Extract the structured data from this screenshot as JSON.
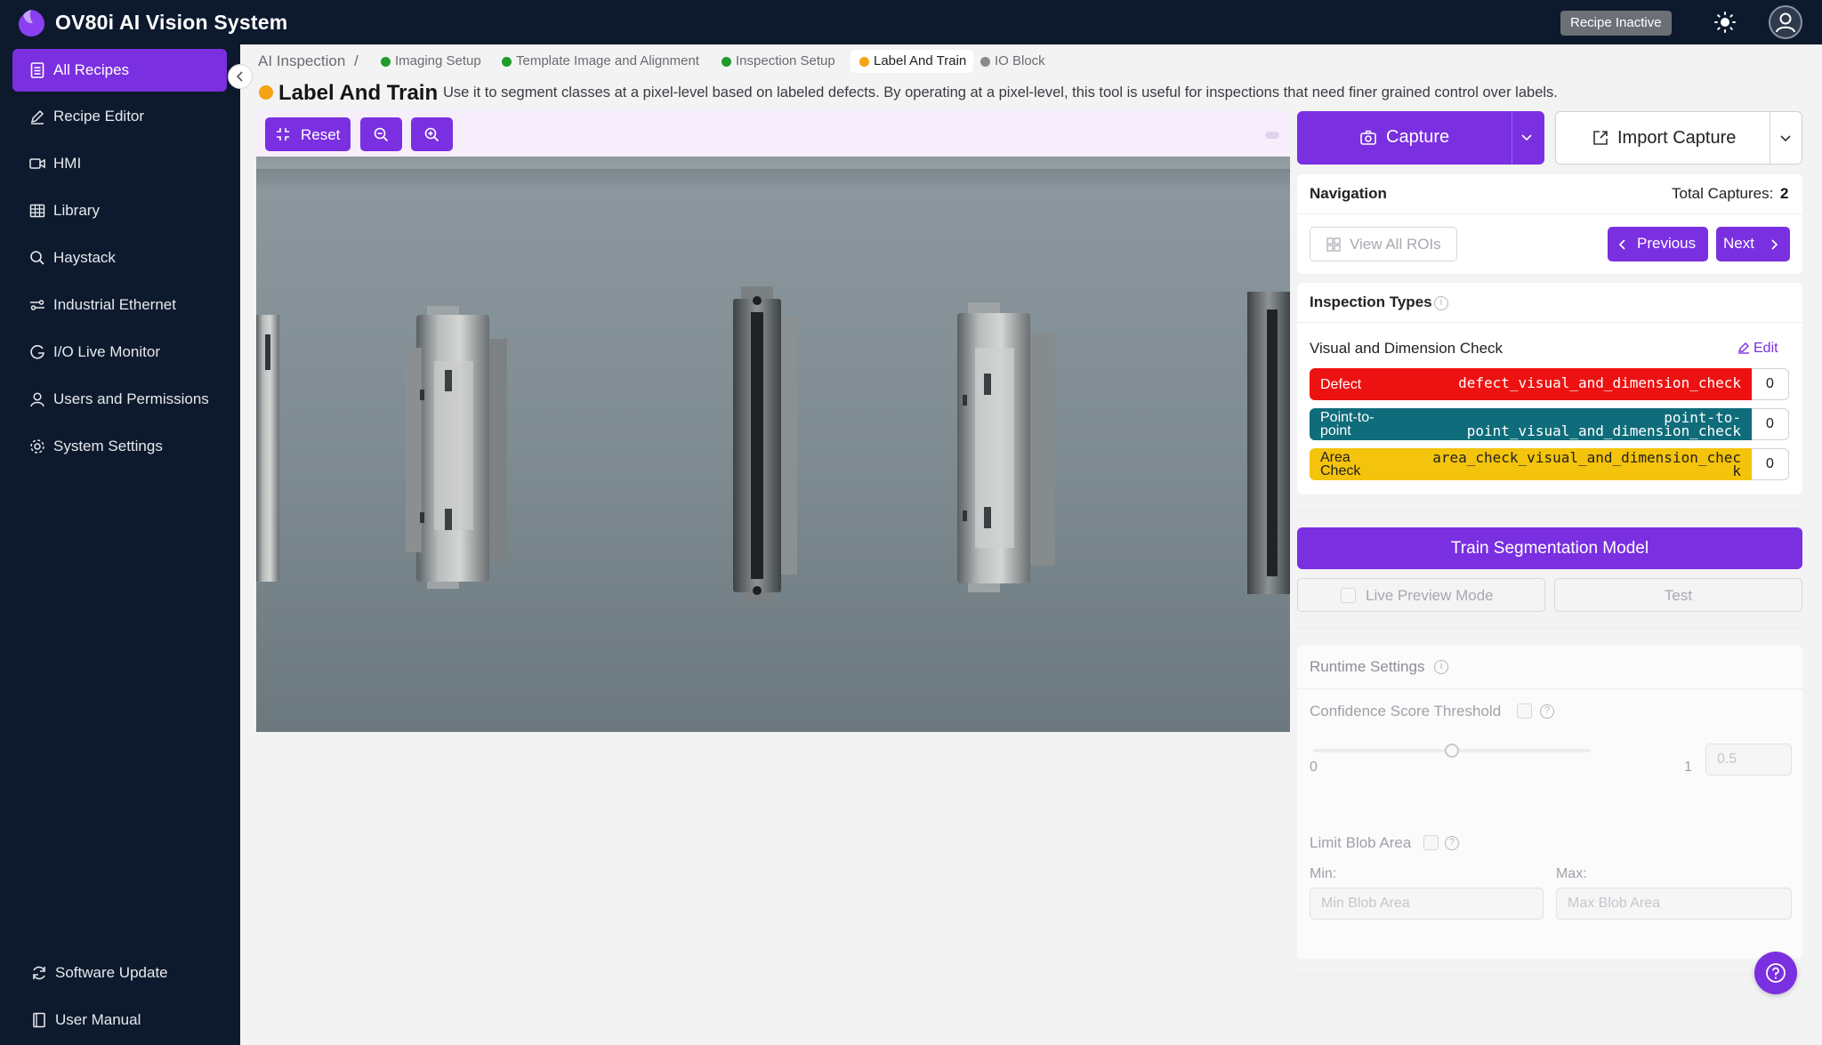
{
  "app": {
    "title": "OV80i AI Vision System",
    "recipe_status": "Recipe Inactive",
    "accent_color": "#7a2fe0",
    "nav_bg_color": "#0d1a2e"
  },
  "sidebar": {
    "items": [
      {
        "label": "All Recipes",
        "icon": "document-list-icon",
        "active": true
      },
      {
        "label": "Recipe Editor",
        "icon": "pencil-icon"
      },
      {
        "label": "HMI",
        "icon": "video-icon"
      },
      {
        "label": "Library",
        "icon": "grid-table-icon"
      },
      {
        "label": "Haystack",
        "icon": "search-icon"
      },
      {
        "label": "Industrial Ethernet",
        "icon": "network-icon"
      },
      {
        "label": "I/O Live Monitor",
        "icon": "monitor-g-icon"
      },
      {
        "label": "Users and Permissions",
        "icon": "user-icon"
      },
      {
        "label": "System Settings",
        "icon": "gear-icon"
      }
    ],
    "footer": [
      {
        "label": "Software Update",
        "icon": "refresh-icon"
      },
      {
        "label": "User Manual",
        "icon": "book-icon"
      }
    ]
  },
  "breadcrumb": {
    "root": "AI Inspection",
    "separator": "/",
    "steps": [
      {
        "label": "Imaging Setup",
        "status_color": "#1f9d2b"
      },
      {
        "label": "Template Image and Alignment",
        "status_color": "#1f9d2b"
      },
      {
        "label": "Inspection Setup",
        "status_color": "#1f9d2b"
      },
      {
        "label": "Label And Train",
        "status_color": "#f5a215",
        "current": true
      },
      {
        "label": "IO Block",
        "status_color": "#8a8a8a"
      }
    ]
  },
  "page": {
    "title": "Label And Train",
    "description": "Use it to segment classes at a pixel-level based on labeled defects. By operating at a pixel-level, this tool is useful for inspections that need finer grained control over labels."
  },
  "toolbar": {
    "reset_label": "Reset",
    "zoom_out_icon": "zoom-out-icon",
    "zoom_in_icon": "zoom-in-icon"
  },
  "capture": {
    "capture_label": "Capture",
    "import_label": "Import Capture"
  },
  "navigation": {
    "title": "Navigation",
    "total_label": "Total Captures:",
    "total_value": "2",
    "view_all_label": "View All ROIs",
    "previous_label": "Previous",
    "next_label": "Next"
  },
  "inspection_types": {
    "title": "Inspection Types",
    "group_name": "Visual and Dimension Check",
    "edit_label": "Edit",
    "rows": [
      {
        "name": "Defect",
        "code": "defect_visual_and_dimension_check",
        "count": "0",
        "color": "#ee1111",
        "text_color": "#ffffff"
      },
      {
        "name_line1": "Point-to-",
        "name_line2": "point",
        "code_line1": "point-to-",
        "code_line2": "point_visual_and_dimension_check",
        "count": "0",
        "color": "#0f6c7a",
        "text_color": "#ffffff"
      },
      {
        "name_line1": "Area",
        "name_line2": "Check",
        "code_line1": "area_check_visual_and_dimension_chec",
        "code_line2": "k",
        "count": "0",
        "color": "#f4c30c",
        "text_color": "#222222"
      }
    ]
  },
  "training": {
    "train_label": "Train Segmentation Model",
    "live_preview_label": "Live Preview Mode",
    "test_label": "Test"
  },
  "runtime": {
    "title": "Runtime Settings",
    "confidence_label": "Confidence Score Threshold",
    "slider_min": "0",
    "slider_max": "1",
    "threshold_value": "0.5",
    "threshold_fraction": 0.5,
    "blob_label": "Limit Blob Area",
    "min_label": "Min:",
    "max_label": "Max:",
    "min_placeholder": "Min Blob Area",
    "max_placeholder": "Max Blob Area"
  }
}
